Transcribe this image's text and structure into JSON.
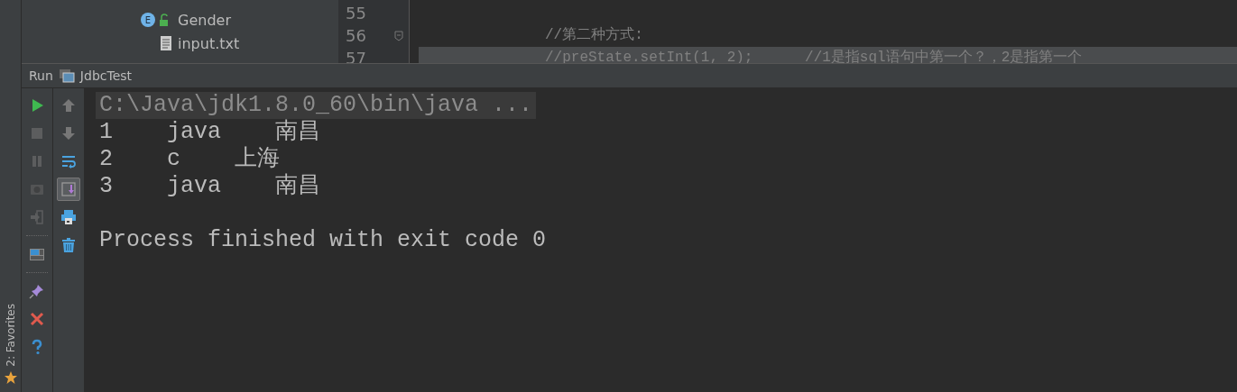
{
  "project_tree": {
    "items": [
      {
        "name": "Gender",
        "kind": "enum",
        "badge": "E"
      },
      {
        "name": "input.txt",
        "kind": "file"
      }
    ]
  },
  "editor": {
    "lines": [
      {
        "number": "55"
      },
      {
        "number": "56",
        "code": "//第二种方式:",
        "folded": true
      },
      {
        "number": "57",
        "code": "//preState.setInt(1, 2);      //1是指sql语句中第一个？，2是指第一个",
        "folded": false
      }
    ]
  },
  "run_panel": {
    "label": "Run",
    "tab": "JdbcTest",
    "tools_left": [
      {
        "kind": "run",
        "disabled": false
      },
      {
        "kind": "stop",
        "disabled": true
      },
      {
        "kind": "pause",
        "disabled": true
      },
      {
        "kind": "camera",
        "disabled": true
      },
      {
        "kind": "exit",
        "disabled": true
      },
      {
        "kind": "separator"
      },
      {
        "kind": "layout",
        "disabled": false
      },
      {
        "kind": "separator"
      },
      {
        "kind": "pin",
        "disabled": false
      },
      {
        "kind": "close",
        "disabled": false
      },
      {
        "kind": "help",
        "disabled": false
      }
    ],
    "tools_right": [
      {
        "kind": "up",
        "on": false
      },
      {
        "kind": "down",
        "on": false
      },
      {
        "kind": "wrap",
        "on": false
      },
      {
        "kind": "scroll-end",
        "on": true
      },
      {
        "kind": "print",
        "on": false
      },
      {
        "kind": "trash",
        "on": false
      }
    ],
    "console": {
      "command": "C:\\Java\\jdk1.8.0_60\\bin\\java ...",
      "lines": [
        {
          "kind": "row",
          "text": "1    java    南昌"
        },
        {
          "kind": "row",
          "text": "2    c    上海"
        },
        {
          "kind": "row",
          "text": "3    java    南昌"
        },
        {
          "kind": "status",
          "text": "Process finished with exit code 0"
        }
      ]
    }
  },
  "side_bar": {
    "label": "2: Favorites"
  }
}
